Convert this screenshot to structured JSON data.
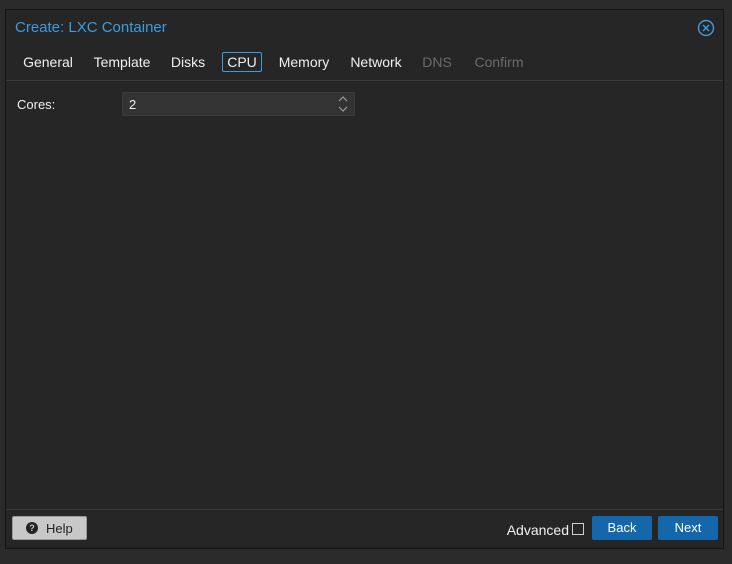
{
  "window": {
    "title": "Create: LXC Container",
    "close_icon": "close-circle-icon"
  },
  "tabs": [
    {
      "label": "General",
      "state": "enabled"
    },
    {
      "label": "Template",
      "state": "enabled"
    },
    {
      "label": "Disks",
      "state": "enabled"
    },
    {
      "label": "CPU",
      "state": "active"
    },
    {
      "label": "Memory",
      "state": "enabled"
    },
    {
      "label": "Network",
      "state": "enabled"
    },
    {
      "label": "DNS",
      "state": "disabled"
    },
    {
      "label": "Confirm",
      "state": "disabled"
    }
  ],
  "form": {
    "cores_label": "Cores:",
    "cores_value": "2"
  },
  "footer": {
    "help_label": "Help",
    "help_icon": "question-circle-icon",
    "advanced_label": "Advanced",
    "advanced_checked": false,
    "back_label": "Back",
    "next_label": "Next"
  },
  "colors": {
    "accent": "#3d9be0",
    "primary_button": "#1467aa",
    "background": "#262626",
    "disabled_text": "#6a6a6a"
  }
}
